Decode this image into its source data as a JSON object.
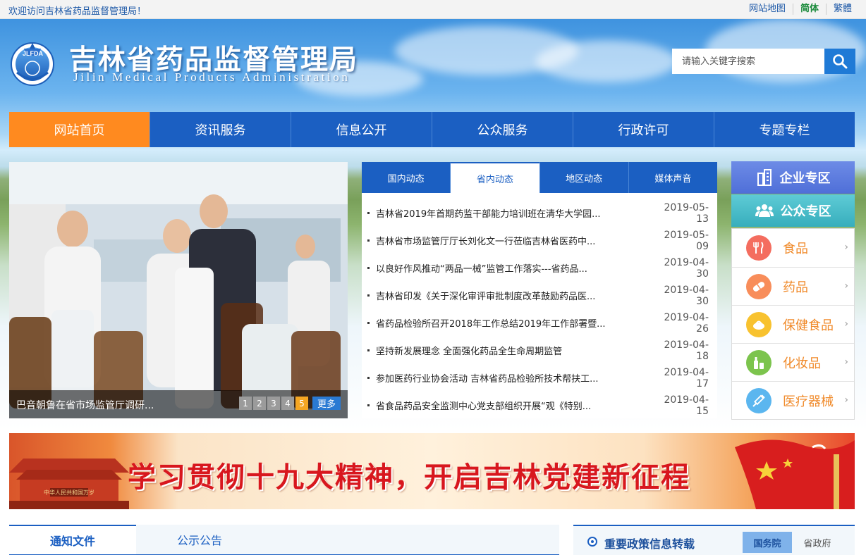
{
  "topbar": {
    "welcome": "欢迎访问吉林省药品监督管理局！",
    "sitemap": "网站地图",
    "simplified": "简体",
    "traditional": "繁體"
  },
  "header": {
    "logo_text": "JLFDA",
    "title": "吉林省药品监督管理局",
    "subtitle": "Jilin Medical Products Administration",
    "search_placeholder": "请输入关键字搜索"
  },
  "nav": [
    "网站首页",
    "资讯服务",
    "信息公开",
    "公众服务",
    "行政许可",
    "专题专栏"
  ],
  "slideshow": {
    "caption": "巴音朝鲁在省市场监管厅调研...",
    "pages": [
      "1",
      "2",
      "3",
      "4",
      "5"
    ],
    "active_page": "5",
    "more": "更多"
  },
  "news": {
    "tabs": [
      "国内动态",
      "省内动态",
      "地区动态",
      "媒体声音"
    ],
    "active_tab": "省内动态",
    "items": [
      {
        "title": "吉林省2019年首期药监干部能力培训班在清华大学园...",
        "date": "2019-05-13"
      },
      {
        "title": "吉林省市场监管厅厅长刘化文一行莅临吉林省医药中...",
        "date": "2019-05-09"
      },
      {
        "title": "以良好作风推动“两品一械”监管工作落实---省药品...",
        "date": "2019-04-30"
      },
      {
        "title": "吉林省印发《关于深化审评审批制度改革鼓励药品医...",
        "date": "2019-04-30"
      },
      {
        "title": "省药品检验所召开2018年工作总结2019年工作部署暨...",
        "date": "2019-04-26"
      },
      {
        "title": "坚持新发展理念 全面强化药品全生命周期监管",
        "date": "2019-04-18"
      },
      {
        "title": "参加医药行业协会活动 吉林省药品检验所技术帮扶工...",
        "date": "2019-04-17"
      },
      {
        "title": "省食品药品安全监测中心党支部组织开展“观《特别...",
        "date": "2019-04-15"
      }
    ]
  },
  "zones": {
    "enterprise": "企业专区",
    "public": "公众专区"
  },
  "categories": [
    {
      "label": "食品",
      "icon": "utensils-icon",
      "color": "#f46d5f"
    },
    {
      "label": "药品",
      "icon": "pill-icon",
      "color": "#f88d5a"
    },
    {
      "label": "保健食品",
      "icon": "health-food-icon",
      "color": "#f8c22f"
    },
    {
      "label": "化妆品",
      "icon": "cosmetics-icon",
      "color": "#7cc44d"
    },
    {
      "label": "医疗器械",
      "icon": "syringe-icon",
      "color": "#5bb6ef"
    }
  ],
  "banner": {
    "slogan": "学习贯彻十九大精神，开启吉林党建新征程",
    "gate_plaque": "中华人民共和国万岁"
  },
  "bottom": {
    "tabs": [
      "通知文件",
      "公示公告"
    ],
    "active_tab": "通知文件",
    "policy_title": "重要政策信息转载",
    "policy_sources": [
      "国务院",
      "省政府"
    ]
  },
  "colors": {
    "nav_blue": "#1b5fc2",
    "nav_active": "#ff8a1f",
    "accent_green": "#1a8a3a",
    "category_text": "#f08a2a"
  }
}
